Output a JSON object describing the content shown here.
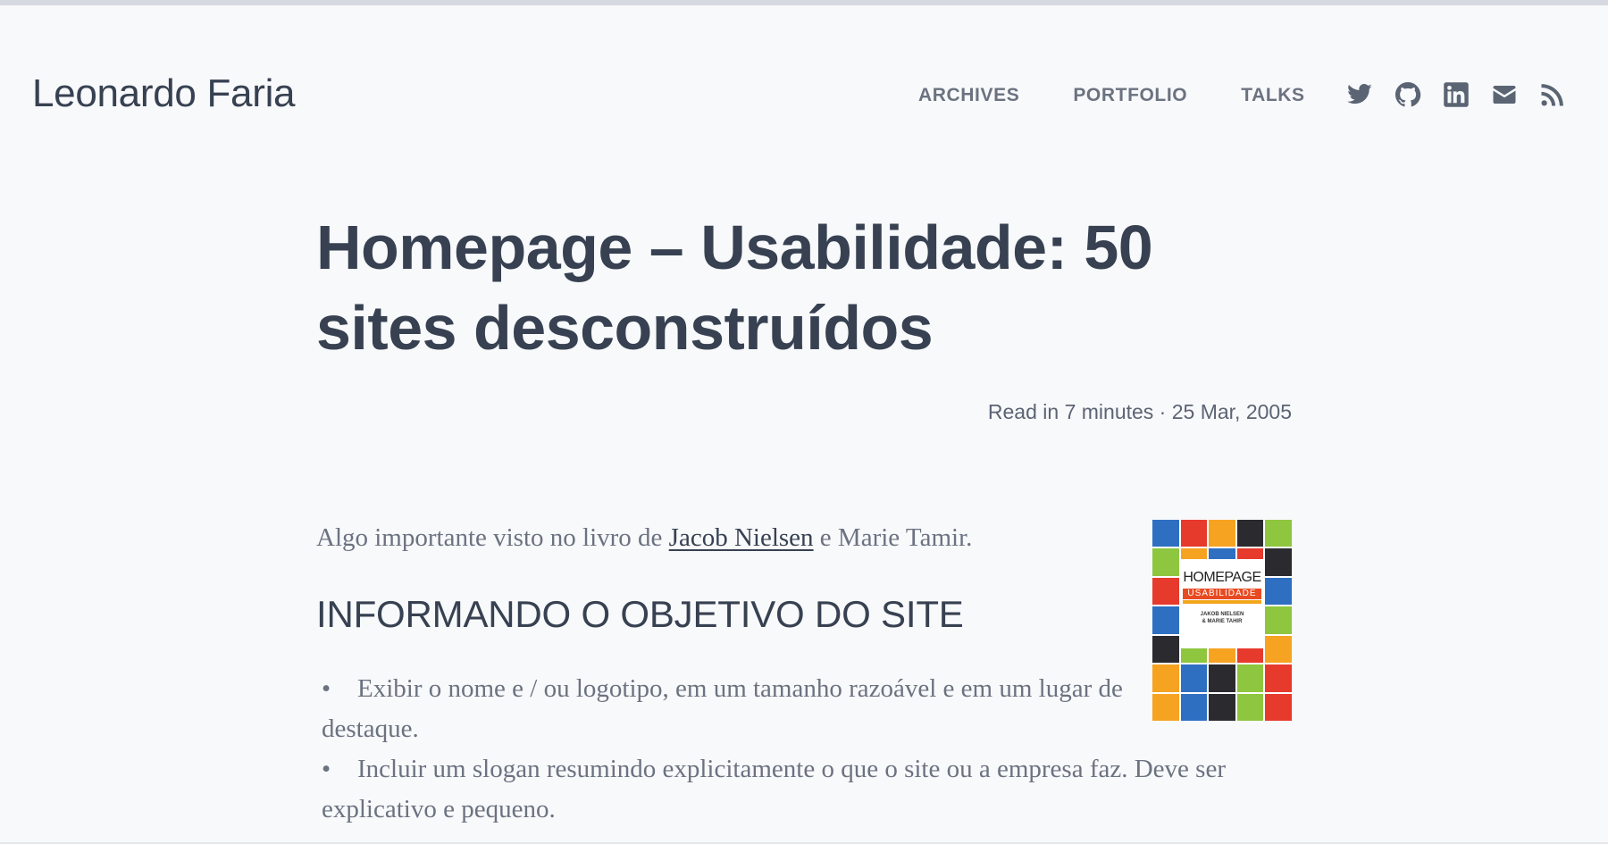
{
  "site": {
    "title": "Leonardo Faria"
  },
  "nav": {
    "items": [
      {
        "label": "ARCHIVES"
      },
      {
        "label": "PORTFOLIO"
      },
      {
        "label": "TALKS"
      }
    ]
  },
  "social": {
    "icons": [
      "twitter-icon",
      "github-icon",
      "linkedin-icon",
      "email-icon",
      "rss-icon"
    ],
    "icon_color": "#5b6473"
  },
  "post": {
    "title": "Homepage – Usabilidade: 50 sites desconstruídos",
    "meta": "Read in 7 minutes · 25 Mar, 2005",
    "intro_before": "Algo importante visto no livro de ",
    "intro_link": "Jacob Nielsen",
    "intro_after": " e Marie Tamir.",
    "section_heading": "INFORMANDO O OBJETIVO DO SITE",
    "bullets": [
      "Exibir o nome e / ou logotipo, em um tamanho razoável e em um lugar de destaque.",
      "Incluir um slogan resumindo explicitamente o que o site ou a empresa faz. Deve ser explicativo e pequeno."
    ]
  },
  "book": {
    "title": "HOMEPAGE",
    "subtitle": "USABILIDADE",
    "authors_line1": "JAKOB NIELSEN",
    "authors_line2": "& MARIE TAHIR"
  },
  "colors": {
    "background": "#f8f9fb",
    "text_primary": "#374151",
    "text_muted": "#6b7280"
  }
}
